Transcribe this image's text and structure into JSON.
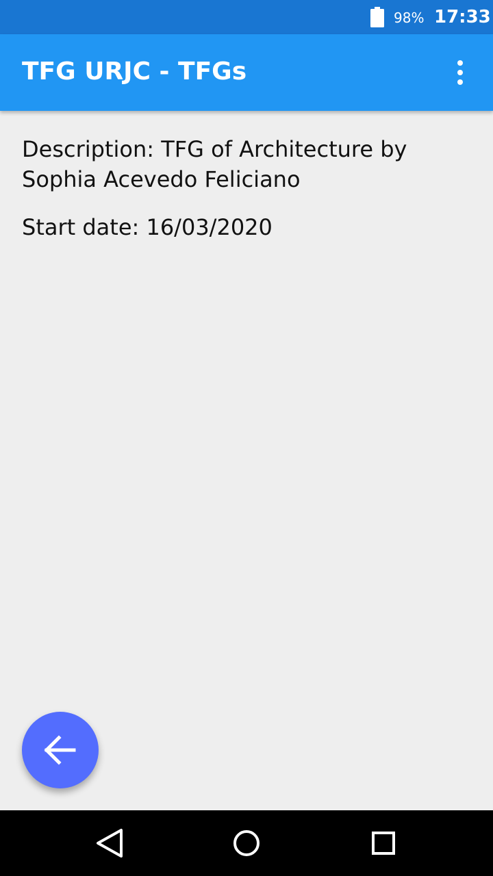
{
  "status_bar": {
    "battery_icon": "battery-icon",
    "battery": "98%",
    "time": "17:33"
  },
  "app_bar": {
    "title": "TFG URJC - TFGs",
    "overflow_icon": "more-vert-icon"
  },
  "details": {
    "description": "Description: TFG of Architecture by Sophia Acevedo Feliciano",
    "start_date": "Start date: 16/03/2020"
  },
  "fab": {
    "icon": "arrow-back-icon"
  },
  "nav_bar": {
    "back_icon": "nav-back-icon",
    "home_icon": "nav-home-icon",
    "recents_icon": "nav-recents-icon"
  },
  "colors": {
    "status_bar": "#1976D2",
    "app_bar": "#2196F3",
    "background": "#EEEEEE",
    "fab": "#536DFE",
    "nav_bar": "#000000"
  }
}
